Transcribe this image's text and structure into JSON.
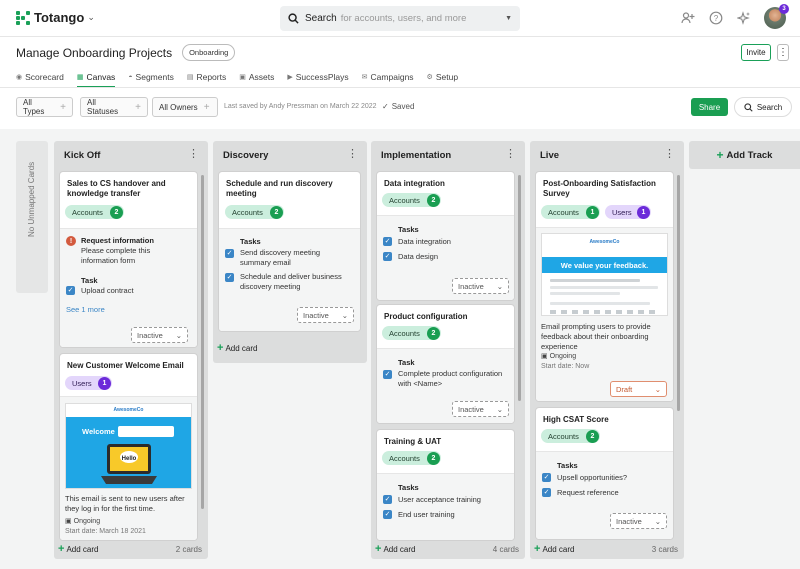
{
  "app": {
    "name": "Totango",
    "notifications": "3"
  },
  "search": {
    "label": "Search",
    "placeholder": "for accounts, users, and more"
  },
  "page": {
    "title": "Manage Onboarding Projects",
    "tag": "Onboarding",
    "invite": "Invite"
  },
  "tabs": [
    {
      "label": "Scorecard",
      "icon": "scorecard-icon"
    },
    {
      "label": "Canvas",
      "icon": "canvas-icon",
      "active": true
    },
    {
      "label": "Segments",
      "icon": "segments-icon"
    },
    {
      "label": "Reports",
      "icon": "reports-icon"
    },
    {
      "label": "Assets",
      "icon": "assets-icon"
    },
    {
      "label": "SuccessPlays",
      "icon": "successplays-icon"
    },
    {
      "label": "Campaigns",
      "icon": "campaigns-icon"
    },
    {
      "label": "Setup",
      "icon": "setup-icon"
    }
  ],
  "filters": {
    "types": "All Types",
    "statuses": "All Statuses",
    "owners": "All Owners",
    "saved_note": "Last saved by Andy Pressman on March 22 2022",
    "saved": "Saved",
    "share": "Share",
    "search": "Search"
  },
  "board": {
    "unmapped": "No Unmapped Cards",
    "add_card": "Add card",
    "add_track": "Add Track",
    "columns": [
      {
        "title": "Kick Off",
        "count": "2 cards",
        "cards": [
          {
            "title": "Sales to CS handover and knowledge transfer",
            "chip_label": "Accounts",
            "chip_count": "2",
            "req_title": "Request information",
            "req_text": "Please complete this information form",
            "task_header": "Task",
            "task": "Upload contract",
            "more": "See 1 more",
            "status": "Inactive"
          },
          {
            "title": "New Customer Welcome Email",
            "chip_label": "Users",
            "chip_count": "1",
            "email_brand": "AwesomeCo",
            "email_headline": "Welcome",
            "email_bubble": "Hello",
            "description": "This email is sent to new users after they log in for the first time.",
            "state": "Ongoing",
            "start": "Start date: March 18 2021"
          }
        ]
      },
      {
        "title": "Discovery",
        "cards": [
          {
            "title": "Schedule and run discovery meeting",
            "chip_label": "Accounts",
            "chip_count": "2",
            "tasks_header": "Tasks",
            "tasks": [
              "Send discovery meeting summary email",
              "Schedule and deliver business discovery meeting"
            ],
            "status": "Inactive"
          }
        ]
      },
      {
        "title": "Implementation",
        "count": "4 cards",
        "cards": [
          {
            "title": "Data integration",
            "chip_label": "Accounts",
            "chip_count": "2",
            "tasks_header": "Tasks",
            "tasks": [
              "Data integration",
              "Data design"
            ],
            "status": "Inactive"
          },
          {
            "title": "Product configuration",
            "chip_label": "Accounts",
            "chip_count": "2",
            "tasks_header": "Task",
            "tasks": [
              "Complete product configuration with <Name>"
            ],
            "status": "Inactive"
          },
          {
            "title": "Training & UAT",
            "chip_label": "Accounts",
            "chip_count": "2",
            "tasks_header": "Tasks",
            "tasks": [
              "User acceptance training",
              "End user training"
            ]
          }
        ]
      },
      {
        "title": "Live",
        "count": "3 cards",
        "cards": [
          {
            "title": "Post-Onboarding Satisfaction Survey",
            "chip_label": "Accounts",
            "chip_count": "1",
            "chip2_label": "Users",
            "chip2_count": "1",
            "email_brand": "AwesomeCo",
            "email_headline": "We value your feedback.",
            "description": "Email prompting users to provide feedback about their onboarding experience",
            "state": "Ongoing",
            "start": "Start date: Now",
            "status": "Draft"
          },
          {
            "title": "High CSAT Score",
            "chip_label": "Accounts",
            "chip_count": "2",
            "tasks_header": "Tasks",
            "tasks": [
              "Upsell opportunities?",
              "Request reference"
            ],
            "status": "Inactive"
          }
        ]
      }
    ]
  },
  "colors": {
    "accent": "#1aa058",
    "accounts_chip": "#cbeedd",
    "users_chip": "#e3d6fb",
    "checkbox": "#3b86c6",
    "draft": "#e08e6f"
  }
}
